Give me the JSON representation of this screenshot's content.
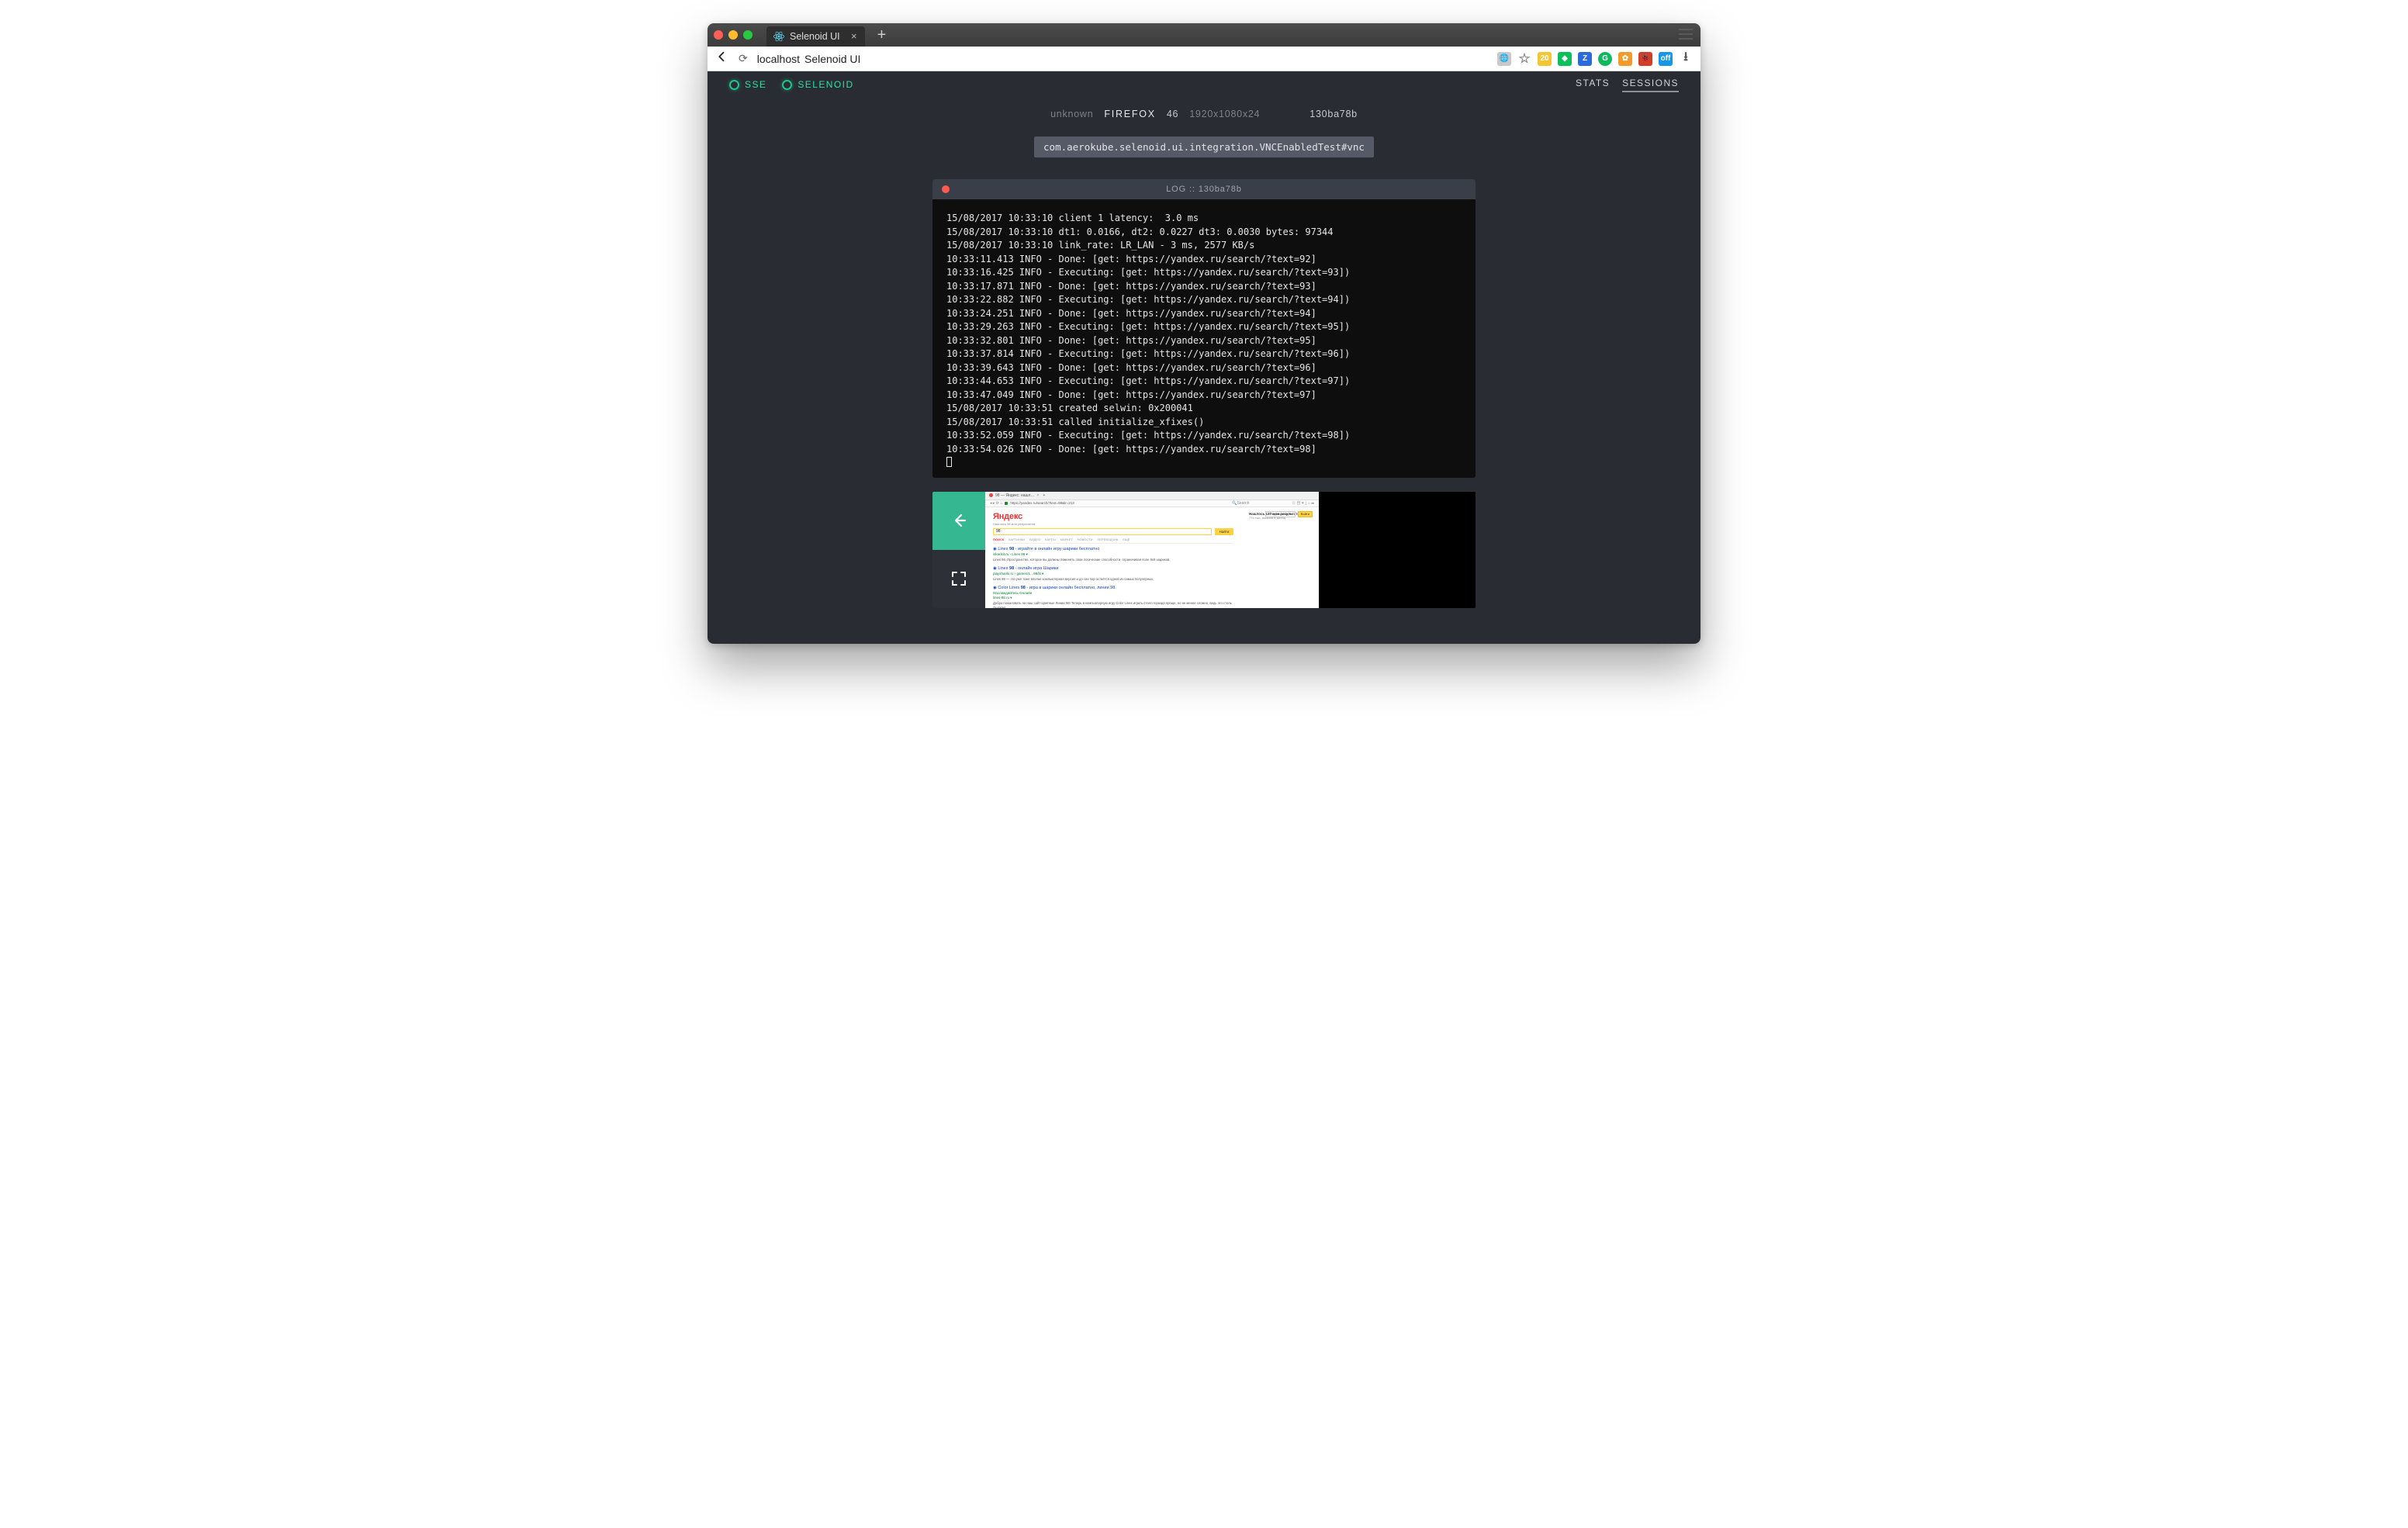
{
  "browserTab": {
    "title": "Selenoid UI"
  },
  "addressBar": {
    "host": "localhost",
    "pageTitle": "Selenoid UI"
  },
  "nav": {
    "sse": "SSE",
    "selenoid": "SELENOID",
    "stats": "STATS",
    "sessions": "SESSIONS"
  },
  "session": {
    "unknownLabel": "unknown",
    "browser": "FIREFOX",
    "version": "46",
    "resolution": "1920x1080x24",
    "id": "130ba78b",
    "testName": "com.aerokube.selenoid.ui.integration.VNCEnabledTest#vnc"
  },
  "log": {
    "titlePrefix": "LOG",
    "titleSep": "::",
    "titleId": "130ba78b",
    "lines": [
      "15/08/2017 10:33:10 client 1 latency:  3.0 ms",
      "15/08/2017 10:33:10 dt1: 0.0166, dt2: 0.0227 dt3: 0.0030 bytes: 97344",
      "15/08/2017 10:33:10 link_rate: LR_LAN - 3 ms, 2577 KB/s",
      "10:33:11.413 INFO - Done: [get: https://yandex.ru/search/?text=92]",
      "10:33:16.425 INFO - Executing: [get: https://yandex.ru/search/?text=93])",
      "10:33:17.871 INFO - Done: [get: https://yandex.ru/search/?text=93]",
      "10:33:22.882 INFO - Executing: [get: https://yandex.ru/search/?text=94])",
      "10:33:24.251 INFO - Done: [get: https://yandex.ru/search/?text=94]",
      "10:33:29.263 INFO - Executing: [get: https://yandex.ru/search/?text=95])",
      "10:33:32.801 INFO - Done: [get: https://yandex.ru/search/?text=95]",
      "10:33:37.814 INFO - Executing: [get: https://yandex.ru/search/?text=96])",
      "10:33:39.643 INFO - Done: [get: https://yandex.ru/search/?text=96]",
      "10:33:44.653 INFO - Executing: [get: https://yandex.ru/search/?text=97])",
      "10:33:47.049 INFO - Done: [get: https://yandex.ru/search/?text=97]",
      "15/08/2017 10:33:51 created selwin: 0x200041",
      "15/08/2017 10:33:51 called initialize_xfixes()",
      "10:33:52.059 INFO - Executing: [get: https://yandex.ru/search/?text=98])",
      "10:33:54.026 INFO - Done: [get: https://yandex.ru/search/?text=98]"
    ]
  },
  "vnc": {
    "tabTitle": "98 — Яндекс: нашл…",
    "url": "https://yandex.ru/search/?text=98&lr=213",
    "brand": "Яндекс",
    "brandSub": "Нашлось 98 млн результатов",
    "query": "98",
    "searchButton": "Найти",
    "tabs": [
      "ПОИСК",
      "КАРТИНКИ",
      "ВИДЕО",
      "КАРТЫ",
      "МАРКЕТ",
      "НОВОСТИ",
      "ПЕРЕВОДЧИК",
      "ЕЩЁ"
    ],
    "resultsCountBold": "Нашлось 127 млн результатов",
    "resultsCountSub": "774 тыс. показов в месяц",
    "cornerCreate": "Создать аккаунт",
    "cornerEnter": "Войти",
    "results": [
      {
        "titlePre": "Lines ",
        "titleQ": "98",
        "titlePost": " - играйте в онлайн игру шарики бесплатно",
        "url": "iskarikit.ru › Lines 98 ▾",
        "desc": "Lines 98. Пространство, которое вы должны поменять свои логические способности, ограничивая поле 9х9 шариков."
      },
      {
        "titlePre": "Lines ",
        "titleQ": "98",
        "titlePost": " - онлайн игра Шарики",
        "url": "playshariki.ru › games/1…98/lit ▾",
        "desc": "Lines 98 — это уже тоже вполне компьютерная версия и до сих пор остаётся одной из самых популярных."
      },
      {
        "titlePre": "Color Lines ",
        "titleQ": "98",
        "titlePost": " - игра в шарики онлайн бесплатно, линии 98.",
        "url": "Наслаждайтесь Онлайн",
        "url2": "lines-98.ru ▾",
        "desc": "Добро пожаловать на наш сайт Цветные Линии 98! Теперь в компьютерную игру Color Lines играть стало гораздо проще, но не менее сложно, ведь это столь Онлайн!"
      }
    ]
  }
}
